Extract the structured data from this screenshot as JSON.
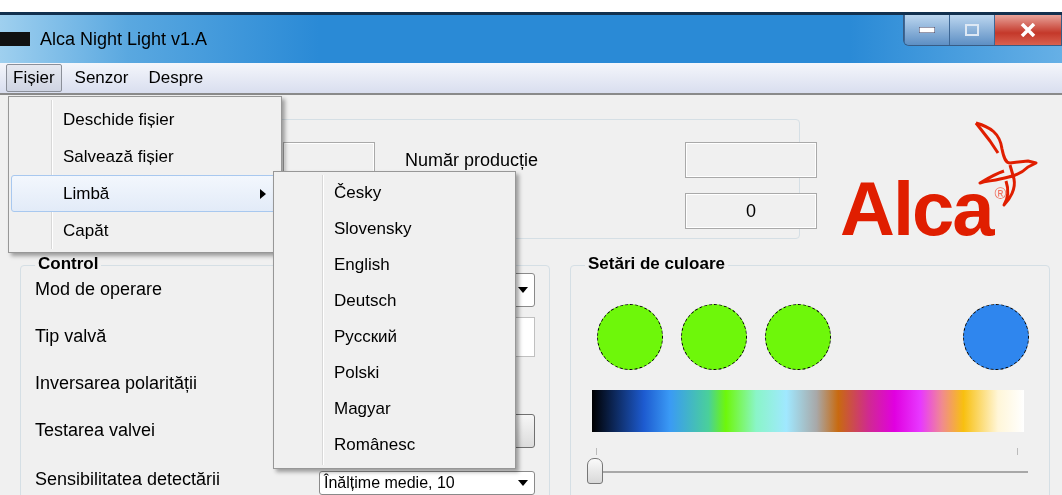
{
  "window": {
    "title": "Alca Night Light  v1.A"
  },
  "menu_bar": [
    {
      "label": "Fișier",
      "selected": true
    },
    {
      "label": "Senzor",
      "selected": false
    },
    {
      "label": "Despre",
      "selected": false
    }
  ],
  "file_menu": [
    {
      "label": "Deschide fișier",
      "selected": false,
      "submenu": false
    },
    {
      "label": "Salvează fișier",
      "selected": false,
      "submenu": false
    },
    {
      "label": "Limbă",
      "selected": true,
      "submenu": true
    },
    {
      "label": "Capăt",
      "selected": false,
      "submenu": false
    }
  ],
  "language_menu": [
    "Česky",
    "Slovensky",
    "English",
    "Deutsch",
    "Русский",
    "Polski",
    "Magyar",
    "Românesc"
  ],
  "production": {
    "label": "Număr producție",
    "counter": "0"
  },
  "logo": {
    "text": "Alca",
    "mark": "®"
  },
  "control": {
    "title": "Control",
    "rows": [
      {
        "label": "Mod de operare",
        "kind": "dropdown"
      },
      {
        "label": "Tip valvă",
        "kind": "field"
      },
      {
        "label": "Inversarea polarității",
        "kind": "none"
      },
      {
        "label": "Testarea valvei",
        "kind": "button"
      },
      {
        "label": "Sensibilitatea detectării",
        "kind": "dropdown",
        "value": "Înălțime medie, 10"
      }
    ]
  },
  "colors": {
    "title": "Setări de culoare",
    "swatches": [
      {
        "color": "#6ef70a"
      },
      {
        "color": "#6ef70a"
      },
      {
        "color": "#6ef70a"
      },
      {
        "color": "#2f86ee"
      }
    ],
    "slider": {
      "level": 0
    }
  }
}
